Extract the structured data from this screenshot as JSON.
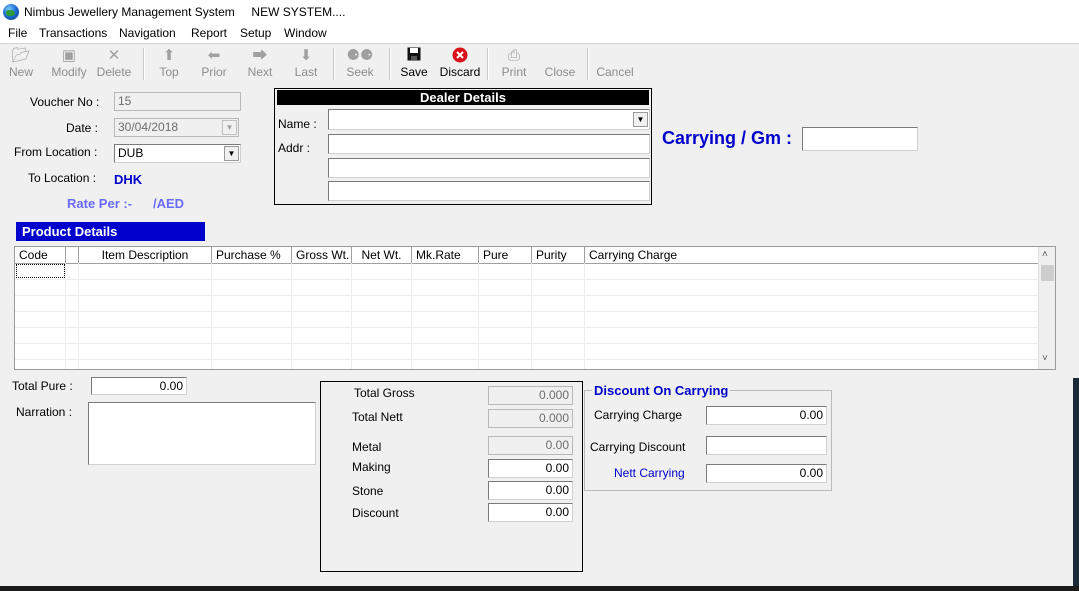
{
  "window": {
    "title": "Nimbus Jewellery Management System     NEW SYSTEM...."
  },
  "menu": [
    "File",
    "Transactions",
    "Navigation",
    "Report",
    "Setup",
    "Window"
  ],
  "toolbar": {
    "new": "New",
    "modify": "Modify",
    "delete": "Delete",
    "top": "Top",
    "prior": "Prior",
    "next": "Next",
    "last": "Last",
    "seek": "Seek",
    "save": "Save",
    "discard": "Discard",
    "print": "Print",
    "close": "Close",
    "cancel": "Cancel"
  },
  "form": {
    "voucher_label": "Voucher No :",
    "voucher_value": "15",
    "date_label": "Date :",
    "date_value": "30/04/2018",
    "from_label": "From Location :",
    "from_value": "DUB",
    "to_label": "To Location :",
    "to_value": "DHK",
    "rate_label": "Rate Per :-",
    "rate_unit": "/AED",
    "carrying_label": "Carrying / Gm :",
    "carrying_value": ""
  },
  "dealer": {
    "header": "Dealer Details",
    "name_label": "Name :",
    "name_value": "",
    "addr_label": "Addr :",
    "addr1": "",
    "addr2": "",
    "addr3": ""
  },
  "product": {
    "header": "Product Details",
    "columns": [
      "Code",
      "Item Description",
      "Purchase %",
      "Gross Wt.",
      "Net Wt.",
      "Mk.Rate",
      "Pure",
      "Purity",
      "Carrying Charge"
    ]
  },
  "bottom": {
    "total_pure_label": "Total  Pure :",
    "total_pure_value": "0.00",
    "narration_label": "Narration :",
    "narration_value": ""
  },
  "totals": {
    "total_gross_label": "Total Gross",
    "total_gross_value": "0.000",
    "total_nett_label": "Total Nett",
    "total_nett_value": "0.000",
    "metal_label": "Metal",
    "metal_value": "0.00",
    "making_label": "Making",
    "making_value": "0.00",
    "stone_label": "Stone",
    "stone_value": "0.00",
    "discount_label": "Discount",
    "discount_value": "0.00"
  },
  "discount_carrying": {
    "title": "Discount On Carrying",
    "carrying_charge_label": "Carrying Charge",
    "carrying_charge_value": "0.00",
    "carrying_discount_label": "Carrying Discount",
    "carrying_discount_value": "",
    "nett_carrying_label": "Nett Carrying",
    "nett_carrying_value": "0.00"
  },
  "colors": {
    "accent_blue": "#0000cc",
    "rate_blue": "#6a6aff",
    "discard_red": "#d9121b"
  }
}
